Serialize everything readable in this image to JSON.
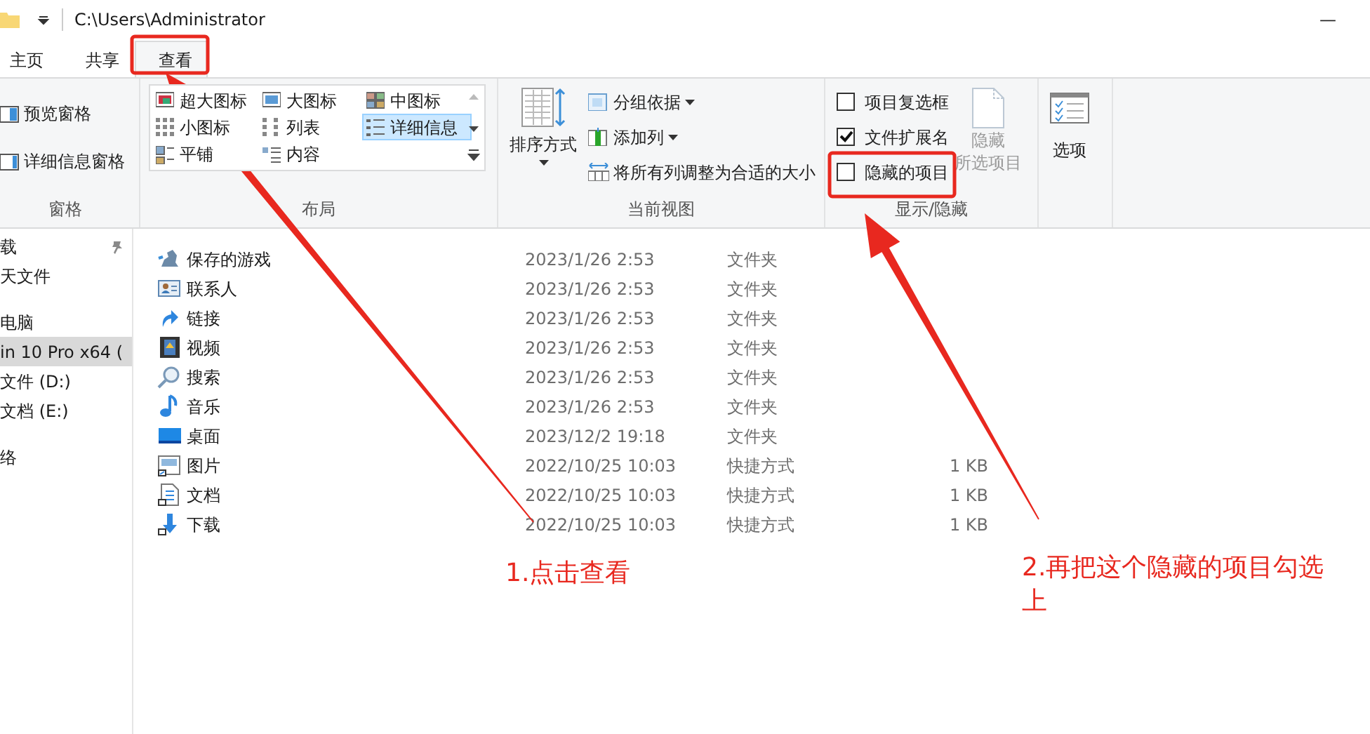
{
  "window": {
    "path": "C:\\Users\\Administrator",
    "minimize": "—"
  },
  "tabs": [
    {
      "label": "主页",
      "selected": false
    },
    {
      "label": "共享",
      "selected": false
    },
    {
      "label": "查看",
      "selected": true
    }
  ],
  "ribbon": {
    "panes": {
      "items": [
        "预览窗格",
        "详细信息窗格"
      ],
      "label": "窗格"
    },
    "layout": {
      "items": [
        {
          "label": "超大图标",
          "selected": false
        },
        {
          "label": "大图标",
          "selected": false
        },
        {
          "label": "中图标",
          "selected": false
        },
        {
          "label": "小图标",
          "selected": false
        },
        {
          "label": "列表",
          "selected": false
        },
        {
          "label": "详细信息",
          "selected": true
        },
        {
          "label": "平铺",
          "selected": false
        },
        {
          "label": "内容",
          "selected": false
        }
      ],
      "label": "布局"
    },
    "current_view": {
      "sort": "排序方式",
      "items": [
        "分组依据",
        "添加列",
        "将所有列调整为合适的大小"
      ],
      "label": "当前视图"
    },
    "show_hide": {
      "checkboxes": [
        {
          "label": "项目复选框",
          "checked": false
        },
        {
          "label": "文件扩展名",
          "checked": true
        },
        {
          "label": "隐藏的项目",
          "checked": false
        }
      ],
      "hide_selected": {
        "lines": [
          "隐藏",
          "所选项目"
        ],
        "disabled": true
      },
      "label": "显示/隐藏"
    },
    "options": {
      "label": "选项"
    }
  },
  "sidebar": {
    "items": [
      {
        "label": "载",
        "selected": false,
        "pinned": true
      },
      {
        "label": "天文件",
        "selected": false,
        "pinned": false
      },
      {
        "label": "电脑",
        "selected": false,
        "pinned": false
      },
      {
        "label": "in 10 Pro x64 (",
        "selected": true,
        "pinned": false
      },
      {
        "label": "文件 (D:)",
        "selected": false,
        "pinned": false
      },
      {
        "label": "文档 (E:)",
        "selected": false,
        "pinned": false
      },
      {
        "label": "络",
        "selected": false,
        "pinned": false
      }
    ]
  },
  "files": [
    {
      "name": "保存的游戏",
      "modified": "2023/1/26 2:53",
      "type": "文件夹"
    },
    {
      "name": "联系人",
      "modified": "2023/1/26 2:53",
      "type": "文件夹"
    },
    {
      "name": "链接",
      "modified": "2023/1/26 2:53",
      "type": "文件夹"
    },
    {
      "name": "视频",
      "modified": "2023/1/26 2:53",
      "type": "文件夹"
    },
    {
      "name": "搜索",
      "modified": "2023/1/26 2:53",
      "type": "文件夹"
    },
    {
      "name": "音乐",
      "modified": "2023/1/26 2:53",
      "type": "文件夹"
    },
    {
      "name": "桌面",
      "modified": "2023/12/2 19:18",
      "type": "文件夹"
    },
    {
      "name": "图片",
      "modified": "2022/10/25 10:03",
      "type": "快捷方式",
      "size": "1 KB"
    },
    {
      "name": "文档",
      "modified": "2022/10/25 10:03",
      "type": "快捷方式",
      "size": "1 KB"
    },
    {
      "name": "下载",
      "modified": "2022/10/25 10:03",
      "type": "快捷方式",
      "size": "1 KB"
    }
  ],
  "annotations": [
    "1.点击查看",
    "2.再把这个隐藏的项目勾选上"
  ]
}
